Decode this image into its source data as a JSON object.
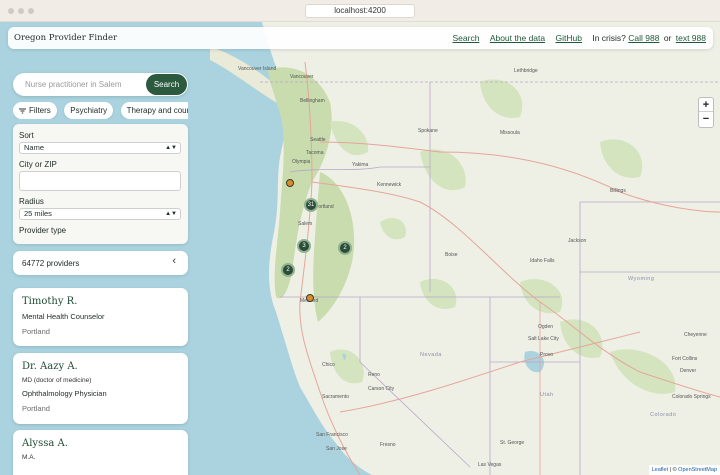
{
  "browser": {
    "url": "localhost:4200"
  },
  "header": {
    "brand": "Oregon Provider Finder",
    "links": {
      "search": "Search",
      "about": "About the data",
      "github": "GitHub"
    },
    "crisis_prefix": "In crisis?",
    "call": "Call 988",
    "or": "or",
    "text": "text 988"
  },
  "search": {
    "placeholder": "Nurse practitioner in Salem",
    "button": "Search"
  },
  "chips": [
    "Filters",
    "Psychiatry",
    "Therapy and counseling"
  ],
  "filters": {
    "sort_label": "Sort",
    "sort_value": "Name",
    "city_label": "City or ZIP",
    "city_value": "",
    "radius_label": "Radius",
    "radius_value": "25 miles",
    "provider_type_label": "Provider type"
  },
  "results": {
    "count_text": "64772 providers"
  },
  "providers": [
    {
      "name": "Timothy R.",
      "credential": "",
      "title": "Mental Health Counselor",
      "city": "Portland"
    },
    {
      "name": "Dr. Aazy A.",
      "credential": "MD (doctor of medicine)",
      "title": "Ophthalmology Physician",
      "city": "Portland"
    },
    {
      "name": "Alyssa A.",
      "credential": "M.A.",
      "title": "",
      "city": ""
    }
  ],
  "map": {
    "clusters": [
      "31",
      "3",
      "2",
      "2"
    ],
    "cities": [
      "Vancouver Island",
      "Vancouver",
      "Bellingham",
      "Seattle",
      "Tacoma",
      "Olympia",
      "Yakima",
      "Spokane",
      "Kennewick",
      "Portland",
      "Salem",
      "Medford",
      "Boise",
      "Idaho Falls",
      "Jackson",
      "Lethbridge",
      "Missoula",
      "Billings",
      "Ogden",
      "Salt Lake City",
      "Provo",
      "Reno",
      "Chico",
      "Sacramento",
      "Carson City",
      "San Francisco",
      "San Jose",
      "Fresno",
      "St. George",
      "Las Vegas",
      "Fort Collins",
      "Denver",
      "Colorado Springs",
      "Cheyenne"
    ],
    "regions": [
      "Wyoming",
      "Utah",
      "Nevada",
      "Colorado"
    ],
    "zoom_in": "+",
    "zoom_out": "−",
    "attribution_leaflet": "Leaflet",
    "attribution_sep": "| ©",
    "attribution_osm": "OpenStreetMap"
  },
  "theme": {
    "accent": "#2b5a3f",
    "cluster": "#2b4d37",
    "marker": "#d98e2c",
    "water": "#aad3df",
    "land": "#eef0e6",
    "forest": "#c8dcae"
  }
}
